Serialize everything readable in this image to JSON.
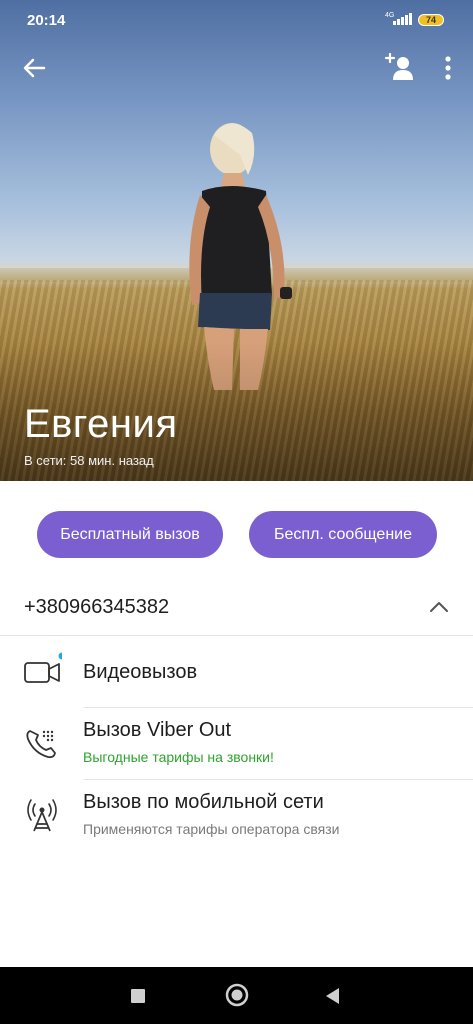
{
  "status_bar": {
    "time": "20:14",
    "network": "4G",
    "battery": "74"
  },
  "header": {
    "back_icon": "arrow-left-icon",
    "add_contact_icon": "add-person-icon",
    "menu_icon": "more-vertical-icon"
  },
  "contact": {
    "name": "Евгения",
    "status": "В сети: 58 мин. назад"
  },
  "actions": {
    "free_call": "Бесплатный вызов",
    "free_message": "Беспл. сообщение"
  },
  "phone": {
    "number": "+380966345382"
  },
  "options": [
    {
      "title": "Видеовызов",
      "icon": "video-camera-icon"
    },
    {
      "title": "Вызов Viber Out",
      "subtitle": "Выгодные тарифы на звонки!",
      "icon": "phone-viber-out-icon"
    },
    {
      "title": "Вызов по мобильной сети",
      "subtitle": "Применяются тарифы оператора связи",
      "icon": "cell-tower-icon"
    }
  ],
  "colors": {
    "accent": "#7b5fd0",
    "promo": "#2ea32e",
    "notification_dot": "#2aa6e8"
  }
}
